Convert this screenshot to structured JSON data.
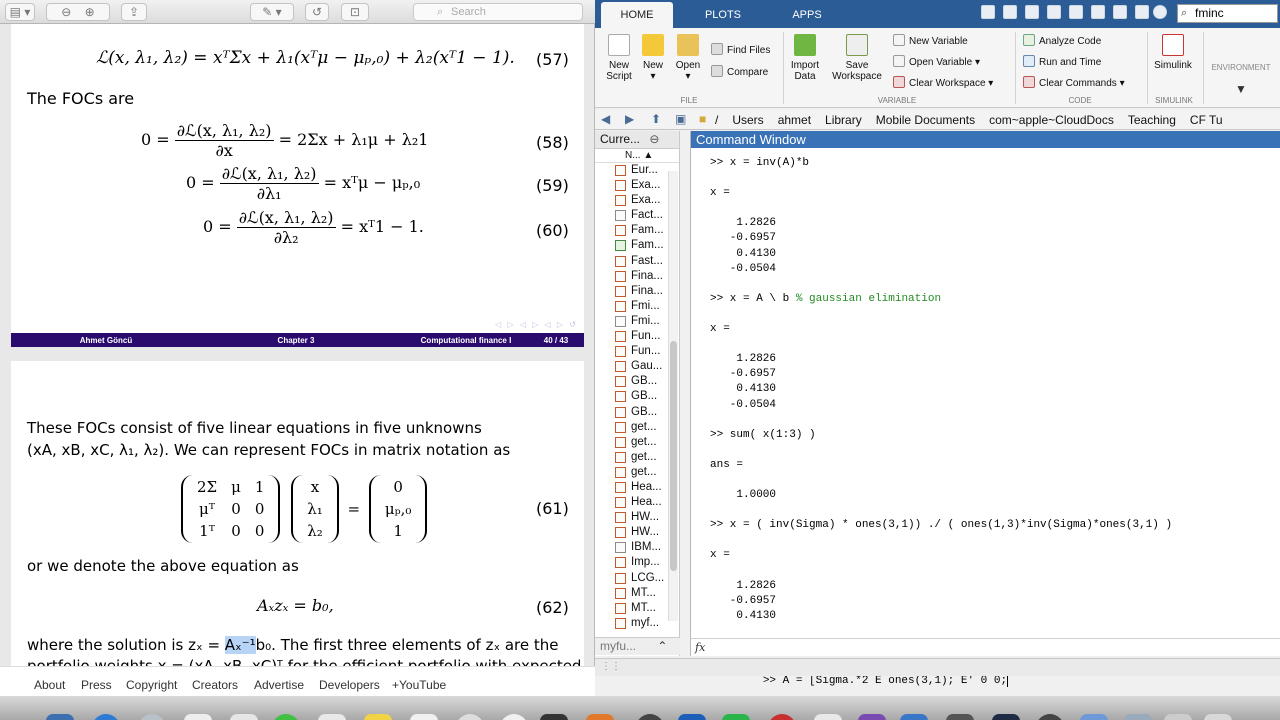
{
  "pdf": {
    "search_placeholder": "Search",
    "page1": {
      "eq57_lhs": "ℒ(x, λ₁, λ₂) = xᵀΣx + λ₁(xᵀμ − μₚ,₀) + λ₂(xᵀ1 − 1).",
      "eq57_no": "(57)",
      "focs_label": "The FOCs are",
      "eq58_lhs": "0 =",
      "eq58_num": "∂ℒ(x, λ₁, λ₂)",
      "eq58_den": "∂x",
      "eq58_rhs": "= 2Σx + λ₁μ + λ₂1",
      "eq58_no": "(58)",
      "eq59_lhs": "0 =",
      "eq59_num": "∂ℒ(x, λ₁, λ₂)",
      "eq59_den": "∂λ₁",
      "eq59_rhs": "= xᵀμ − μₚ,₀",
      "eq59_no": "(59)",
      "eq60_lhs": "0 =",
      "eq60_num": "∂ℒ(x, λ₁, λ₂)",
      "eq60_den": "∂λ₂",
      "eq60_rhs": "= xᵀ1 − 1.",
      "eq60_no": "(60)",
      "footer_author": "Ahmet Göncü",
      "footer_chapter": "Chapter 3",
      "footer_course": "Computational finance I",
      "footer_page": "40 / 43"
    },
    "page2": {
      "para1_line1": "These FOCs consist of five linear equations in five unknowns",
      "para1_line2": "(xA, xB, xC, λ₁, λ₂). We can represent FOCs in matrix notation as",
      "matrix_a": [
        [
          "2Σ",
          "μ",
          "1"
        ],
        [
          "μᵀ",
          "0",
          "0"
        ],
        [
          "1ᵀ",
          "0",
          "0"
        ]
      ],
      "matrix_x": [
        "x",
        "λ₁",
        "λ₂"
      ],
      "matrix_b": [
        "0",
        "μₚ,₀",
        "1"
      ],
      "eq61_no": "(61)",
      "para2": "or we denote the above equation as",
      "eq62": "Aₓzₓ = b₀,",
      "eq62_no": "(62)",
      "para3_start": "where the solution is zₓ = ",
      "para3_highlight": "Aₓ⁻¹",
      "para3_end": "b₀. The first three elements of zₓ are the",
      "para3_line2": "portfolio weights x = (xA, xB, xC)ᵀ for the efficient portfolio with expected"
    }
  },
  "youtube_footer": [
    "About",
    "Press",
    "Copyright",
    "Creators",
    "Advertise",
    "Developers",
    "+YouTube"
  ],
  "matlab": {
    "tabs": [
      "HOME",
      "PLOTS",
      "APPS"
    ],
    "search_value": "fminc",
    "ribbon": {
      "new_script": "New\nScript",
      "new": "New",
      "open": "Open",
      "find_files": "Find Files",
      "compare": "Compare",
      "import_data": "Import\nData",
      "save_workspace": "Save\nWorkspace",
      "new_variable": "New Variable",
      "open_variable": "Open Variable",
      "clear_workspace": "Clear Workspace",
      "analyze_code": "Analyze Code",
      "run_and_time": "Run and Time",
      "clear_commands": "Clear Commands",
      "simulink": "Simulink",
      "environment": "ENVIRONMENT",
      "group_file": "FILE",
      "group_variable": "VARIABLE",
      "group_code": "CODE",
      "group_simulink": "SIMULINK"
    },
    "path": [
      "/",
      "Users",
      "ahmet",
      "Library",
      "Mobile Documents",
      "com~apple~CloudDocs",
      "Teaching",
      "CF Tu"
    ],
    "current_folder_title": "Curre...",
    "current_folder_col": "N...",
    "files": [
      {
        "name": "Eur...",
        "icon": "m"
      },
      {
        "name": "Exa...",
        "icon": "m"
      },
      {
        "name": "Exa...",
        "icon": "m"
      },
      {
        "name": "Fact...",
        "icon": "f"
      },
      {
        "name": "Fam...",
        "icon": "m"
      },
      {
        "name": "Fam...",
        "icon": "x"
      },
      {
        "name": "Fast...",
        "icon": "m"
      },
      {
        "name": "Fina...",
        "icon": "m"
      },
      {
        "name": "Fina...",
        "icon": "m"
      },
      {
        "name": "Fmi...",
        "icon": "m"
      },
      {
        "name": "Fmi...",
        "icon": "f"
      },
      {
        "name": "Fun...",
        "icon": "m"
      },
      {
        "name": "Fun...",
        "icon": "m"
      },
      {
        "name": "Gau...",
        "icon": "m"
      },
      {
        "name": "GB...",
        "icon": "m"
      },
      {
        "name": "GB...",
        "icon": "m"
      },
      {
        "name": "GB...",
        "icon": "m"
      },
      {
        "name": "get...",
        "icon": "m"
      },
      {
        "name": "get...",
        "icon": "m"
      },
      {
        "name": "get...",
        "icon": "m"
      },
      {
        "name": "get...",
        "icon": "m"
      },
      {
        "name": "Hea...",
        "icon": "m"
      },
      {
        "name": "Hea...",
        "icon": "m"
      },
      {
        "name": "HW...",
        "icon": "m"
      },
      {
        "name": "HW...",
        "icon": "m"
      },
      {
        "name": "IBM...",
        "icon": "f"
      },
      {
        "name": "Imp...",
        "icon": "m"
      },
      {
        "name": "LCG...",
        "icon": "m"
      },
      {
        "name": "MT...",
        "icon": "m"
      },
      {
        "name": "MT...",
        "icon": "m"
      },
      {
        "name": "myf...",
        "icon": "m"
      }
    ],
    "current_folder_footer": "myfu...",
    "command_window_title": "Command Window",
    "command_lines": [
      ">> x = inv(A)*b",
      "",
      "x =",
      "",
      "    1.2826",
      "   -0.6957",
      "    0.4130",
      "   -0.0504",
      "",
      ">> x = A \\ b % gaussian elimination",
      "",
      "x =",
      "",
      "    1.2826",
      "   -0.6957",
      "    0.4130",
      "   -0.0504",
      "",
      ">> sum( x(1:3) )",
      "",
      "ans =",
      "",
      "    1.0000",
      "",
      ">> x = ( inv(Sigma) * ones(3,1)) ./ ( ones(1,3)*inv(Sigma)*ones(3,1) )",
      "",
      "x =",
      "",
      "    1.2826",
      "   -0.6957",
      "    0.4130"
    ],
    "prompt_symbol": "fx",
    "command_input": ">> A = [Sigma.*2 E ones(3,1); E' 0 0;"
  }
}
